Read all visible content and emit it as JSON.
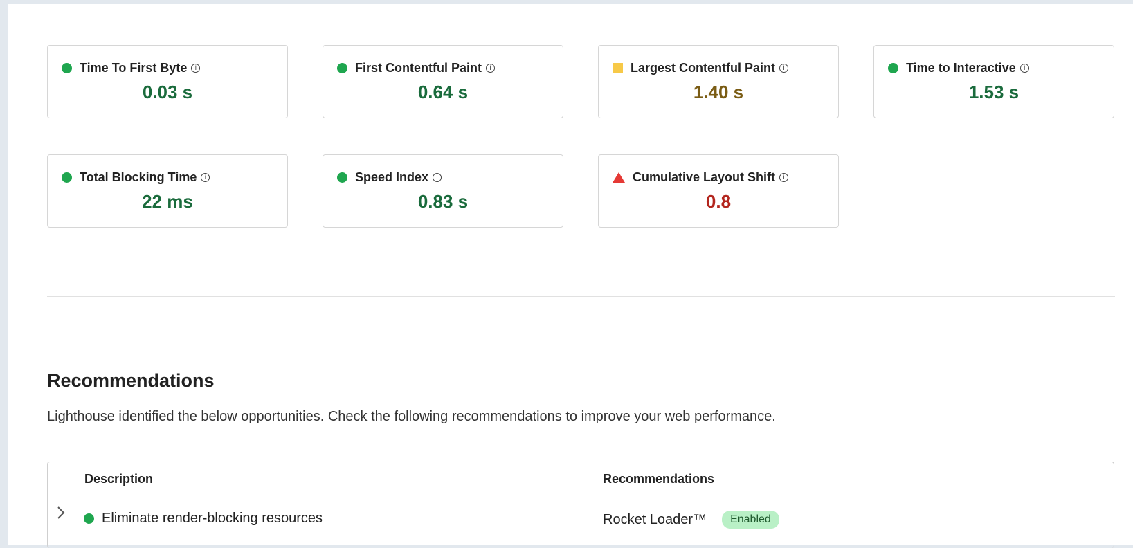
{
  "metrics": [
    {
      "label": "Time To First Byte",
      "value": "0.03 s",
      "indicator": "circle",
      "color": "#1fa64f",
      "value_color": "#1a6b3c"
    },
    {
      "label": "First Contentful Paint",
      "value": "0.64 s",
      "indicator": "circle",
      "color": "#1fa64f",
      "value_color": "#1a6b3c"
    },
    {
      "label": "Largest Contentful Paint",
      "value": "1.40 s",
      "indicator": "square",
      "color": "#f7c948",
      "value_color": "#7a5c14"
    },
    {
      "label": "Time to Interactive",
      "value": "1.53 s",
      "indicator": "circle",
      "color": "#1fa64f",
      "value_color": "#1a6b3c"
    },
    {
      "label": "Total Blocking Time",
      "value": "22 ms",
      "indicator": "circle",
      "color": "#1fa64f",
      "value_color": "#1a6b3c"
    },
    {
      "label": "Speed Index",
      "value": "0.83 s",
      "indicator": "circle",
      "color": "#1fa64f",
      "value_color": "#1a6b3c"
    },
    {
      "label": "Cumulative Layout Shift",
      "value": "0.8",
      "indicator": "triangle",
      "color": "#e53935",
      "value_color": "#b3261e"
    }
  ],
  "info_glyph": "i",
  "recommendations": {
    "title": "Recommendations",
    "subtitle": "Lighthouse identified the below opportunities. Check the following recommendations to improve your web performance.",
    "columns": {
      "description": "Description",
      "recommendations": "Recommendations"
    },
    "rows": [
      {
        "description": "Eliminate render-blocking resources",
        "recommendation": "Rocket Loader™",
        "status": "Enabled",
        "status_color": "#1fa64f"
      }
    ]
  }
}
